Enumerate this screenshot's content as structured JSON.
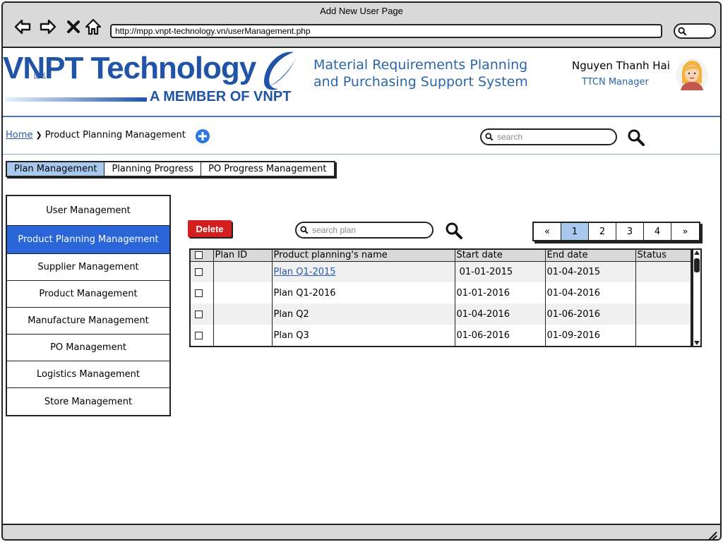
{
  "window": {
    "title": "Add New User Page"
  },
  "browser": {
    "url": "http://mpp.vnpt-technology.vn/userManagement.php",
    "back_icon": "arrow-left-icon",
    "forward_icon": "arrow-right-icon",
    "stop_icon": "close-icon",
    "home_icon": "home-icon"
  },
  "header": {
    "logo_text": "VNPT Technology",
    "logo_subtext": "A MEMBER OF VNPT",
    "logo_link": "link",
    "system_title": "Material Requirements Planning and Purchasing Support System",
    "user_name": "Nguyen Thanh Hai",
    "user_role": "TTCN Manager"
  },
  "breadcrumb": {
    "home": "Home",
    "separator": "❯",
    "current": "Product Planning Management"
  },
  "search": {
    "placeholder": "search"
  },
  "tabs": [
    {
      "label": "Plan Management",
      "active": true
    },
    {
      "label": "Planning Progress",
      "active": false
    },
    {
      "label": "PO Progress Management",
      "active": false
    }
  ],
  "sidebar": {
    "items": [
      {
        "label": "User Management",
        "active": false
      },
      {
        "label": "Product Planning Management",
        "active": true
      },
      {
        "label": "Supplier Management",
        "active": false
      },
      {
        "label": "Product Management",
        "active": false
      },
      {
        "label": "Manufacture Management",
        "active": false
      },
      {
        "label": "PO Management",
        "active": false
      },
      {
        "label": "Logistics Management",
        "active": false
      },
      {
        "label": "Store Management",
        "active": false
      }
    ]
  },
  "toolbar": {
    "delete_label": "Delete",
    "search_placeholder": "search plan"
  },
  "pager": {
    "prev": "«",
    "pages": [
      "1",
      "2",
      "3",
      "4"
    ],
    "current": "1",
    "next": "»"
  },
  "table": {
    "columns": [
      "Plan ID",
      "Product planning's name",
      "Start date",
      "End date",
      "Status"
    ],
    "rows": [
      {
        "plan_id": "",
        "name": "Plan Q1-2015",
        "start": " 01-01-2015",
        "end": "01-04-2015",
        "status": "",
        "is_link": true
      },
      {
        "plan_id": "",
        "name": "Plan Q1-2016",
        "start": "01-01-2016",
        "end": "01-04-2016",
        "status": "",
        "is_link": false
      },
      {
        "plan_id": "",
        "name": "Plan Q2",
        "start": "01-04-2016",
        "end": "01-06-2016",
        "status": "",
        "is_link": false
      },
      {
        "plan_id": "",
        "name": "Plan Q3",
        "start": "01-06-2016",
        "end": "01-09-2016",
        "status": "",
        "is_link": false
      }
    ]
  },
  "colors": {
    "brand_blue": "#1f54a8",
    "title_blue": "#2a66a8",
    "active_tab": "#a9c8ee",
    "active_sidebar": "#2a66d8",
    "delete_red": "#d21f1f"
  }
}
